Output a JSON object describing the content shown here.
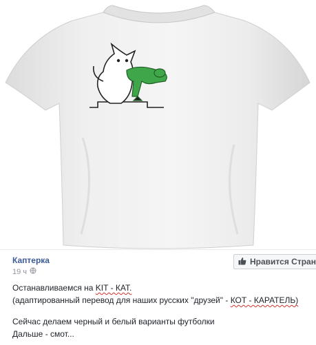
{
  "post": {
    "author": "Каптерка",
    "time": "19 ч",
    "like_label": "Нравится Стран",
    "line1_prefix": "Останавливаемся на ",
    "line1_highlight": "KIT - КАТ.",
    "line2_prefix": "(адаптированный перевод для наших русских \"друзей\" - ",
    "line2_highlight": "КОТ - КАРАТЕЛЬ)",
    "line3": "Сейчас делаем черный и белый варианты футболки",
    "line4": "Дальше - смот..."
  },
  "icons": {
    "privacy": "globe-icon",
    "like": "thumbs-up-icon"
  },
  "colors": {
    "author": "#3b5998",
    "spellcheck": "#d0302a",
    "print_green": "#3fa64a"
  }
}
